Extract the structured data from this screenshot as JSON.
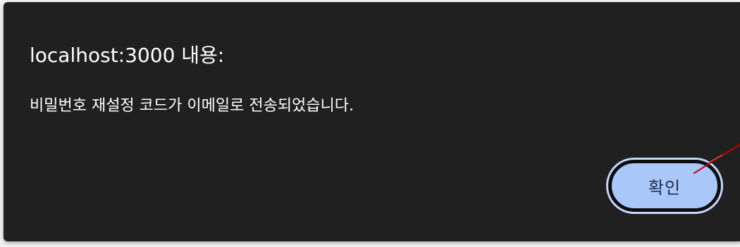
{
  "dialog": {
    "title": "localhost:3000 내용:",
    "message": "비밀번호 재설정 코드가 이메일로 전송되었습니다.",
    "ok_label": "확인"
  },
  "colors": {
    "dialog_background": "#202020",
    "button_background": "#aac7fa",
    "button_ring": "#c4d8ff",
    "annotation_line": "#c00000"
  },
  "icons": {
    "annotation": "hand-drawn-red-line"
  }
}
